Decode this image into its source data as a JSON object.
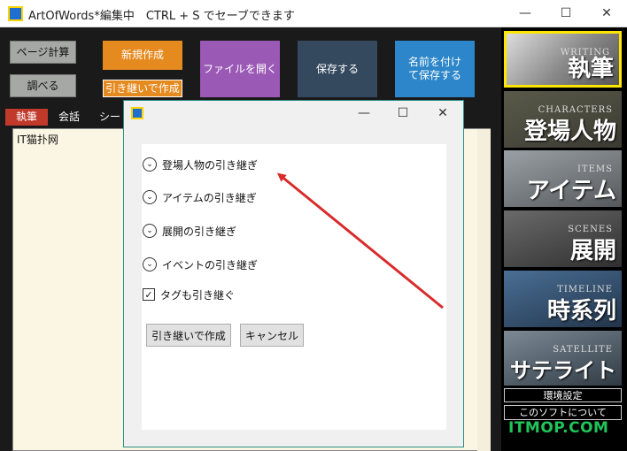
{
  "window": {
    "title": "ArtOfWords*編集中　CTRL + S でセーブできます",
    "minimize": "—",
    "maximize": "☐",
    "close": "✕"
  },
  "toolbar": {
    "page_calc": "ページ計算",
    "lookup": "調べる",
    "new_create": "新規作成",
    "inherit_create": "引き継いで作成",
    "open_file": "ファイルを開く",
    "save": "保存する",
    "save_as": "名前を付けて保存する"
  },
  "tabs": [
    {
      "label": "執筆",
      "active": true
    },
    {
      "label": "会話",
      "active": false
    },
    {
      "label": "シー",
      "active": false
    }
  ],
  "editor": {
    "text": "IT猫扑网"
  },
  "sidebar": {
    "items": [
      {
        "sub": "WRITING",
        "main": "執筆",
        "selected": true
      },
      {
        "sub": "CHARACTERS",
        "main": "登場人物",
        "selected": false
      },
      {
        "sub": "ITEMS",
        "main": "アイテム",
        "selected": false
      },
      {
        "sub": "SCENES",
        "main": "展開",
        "selected": false
      },
      {
        "sub": "TIMELINE",
        "main": "時系列",
        "selected": false
      },
      {
        "sub": "SATELLITE",
        "main": "サテライト",
        "selected": false
      }
    ],
    "settings": "環境設定",
    "about": "このソフトについて",
    "watermark": "ITMOP.COM"
  },
  "dialog": {
    "rows": [
      "登場人物の引き継ぎ",
      "アイテムの引き継ぎ",
      "展開の引き継ぎ",
      "イベントの引き継ぎ"
    ],
    "tags_checkbox": "タグも引き継ぐ",
    "tags_checked": true,
    "create_button": "引き継いで作成",
    "cancel_button": "キャンセル"
  },
  "colors": {
    "orange": "#e58a1f",
    "purple": "#9b59b6",
    "slate": "#34495e",
    "blue": "#2c86c9",
    "tab_active": "#c0392b",
    "selected_border": "#ffe600",
    "arrow": "#d92b2b"
  }
}
